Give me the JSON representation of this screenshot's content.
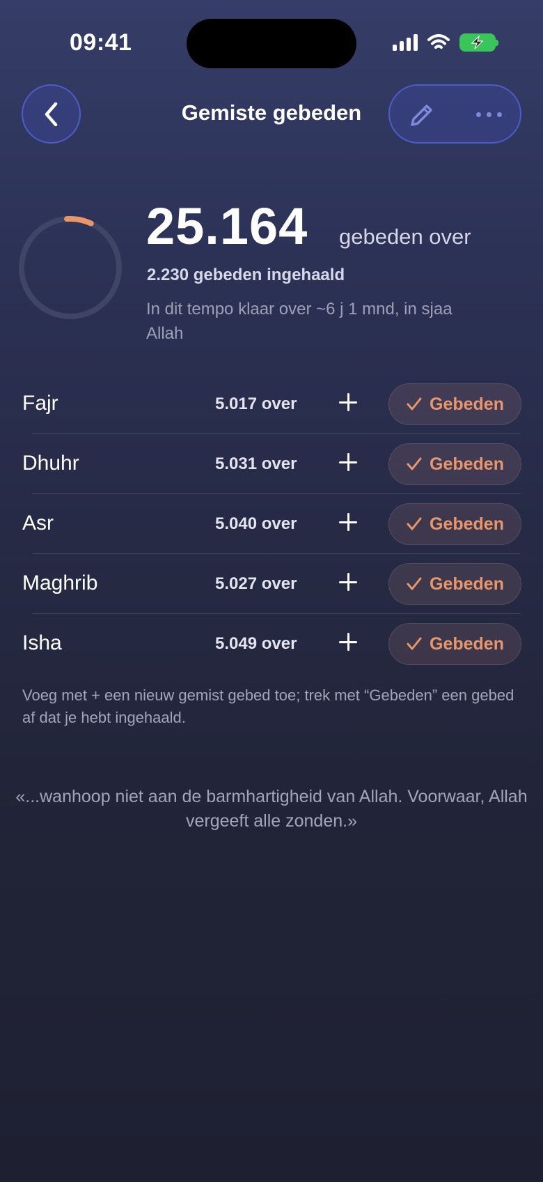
{
  "status_bar": {
    "time": "09:41"
  },
  "header": {
    "title": "Gemiste gebeden"
  },
  "summary": {
    "total_remaining": "25.164",
    "total_suffix": "gebeden over",
    "caught_up": "2.230 gebeden ingehaald",
    "pace_text": "In dit tempo klaar over ~6 j 1 mnd, in sjaa Allah",
    "progress_fraction": 0.081
  },
  "prayers": [
    {
      "name": "Fajr",
      "remaining": "5.017 over",
      "action_label": "Gebeden"
    },
    {
      "name": "Dhuhr",
      "remaining": "5.031 over",
      "action_label": "Gebeden"
    },
    {
      "name": "Asr",
      "remaining": "5.040 over",
      "action_label": "Gebeden"
    },
    {
      "name": "Maghrib",
      "remaining": "5.027 over",
      "action_label": "Gebeden"
    },
    {
      "name": "Isha",
      "remaining": "5.049 over",
      "action_label": "Gebeden"
    }
  ],
  "helper_text": "Voeg met + een nieuw gemist gebed toe; trek met “Gebeden” een gebed af dat je hebt ingehaald.",
  "quote": "«...wanhoop niet aan de barmhartigheid van Allah. Voorwaar, Allah vergeeft alle zonden.»",
  "colors": {
    "accent": "#e9966a",
    "nav_border": "#4d5cc9",
    "battery": "#3ac55b"
  },
  "icons": {
    "back": "chevron-left-icon",
    "edit": "pencil-icon",
    "more": "ellipsis-icon",
    "add": "plus-icon",
    "check": "checkmark-icon"
  }
}
